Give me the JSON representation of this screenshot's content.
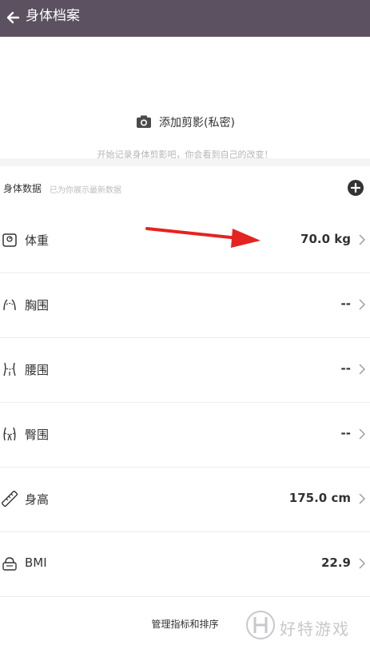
{
  "header": {
    "title": "身体档案"
  },
  "photo": {
    "add_label": "添加剪影(私密)",
    "hint": "开始记录身体剪影吧，你会看到自己的改变！"
  },
  "section": {
    "title": "身体数据",
    "subtitle": "已为你展示最新数据"
  },
  "metrics": [
    {
      "label": "体重",
      "value": "70.0 kg",
      "icon": "scale-icon"
    },
    {
      "label": "胸围",
      "value": "--",
      "icon": "chest-icon"
    },
    {
      "label": "腰围",
      "value": "--",
      "icon": "waist-icon"
    },
    {
      "label": "臀围",
      "value": "--",
      "icon": "hip-icon"
    },
    {
      "label": "身高",
      "value": "175.0 cm",
      "icon": "ruler-icon"
    },
    {
      "label": "BMI",
      "value": "22.9",
      "icon": "bmi-scale-icon"
    }
  ],
  "footer": {
    "manage_label": "管理指标和排序"
  },
  "watermark": {
    "text": "好特游戏"
  },
  "colors": {
    "header_bg": "#5b5160",
    "annotation_arrow": "#e52321"
  }
}
